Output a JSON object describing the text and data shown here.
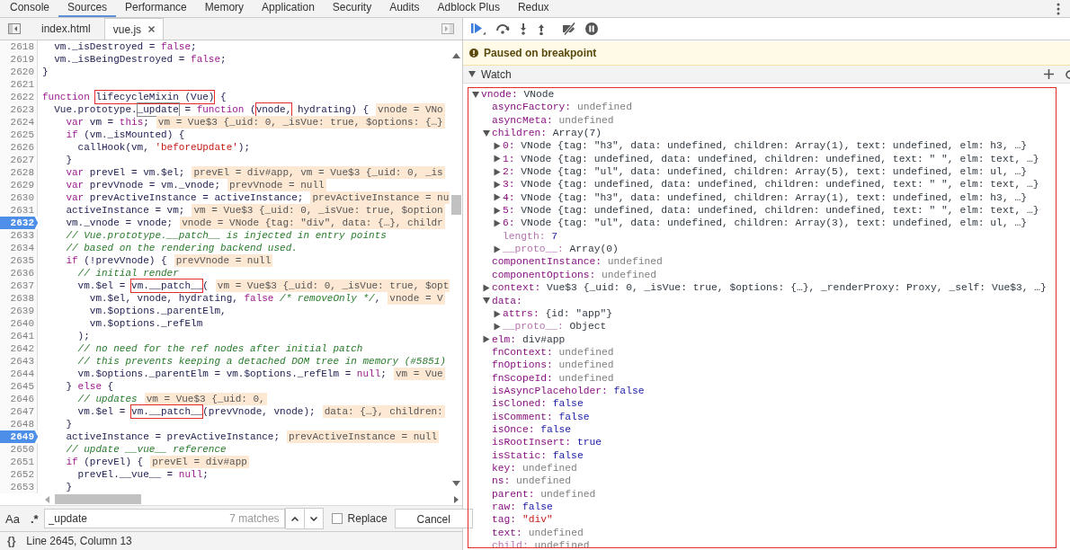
{
  "tabs": [
    {
      "label": "Console",
      "selected": false
    },
    {
      "label": "Sources",
      "selected": true
    },
    {
      "label": "Performance",
      "selected": false
    },
    {
      "label": "Memory",
      "selected": false
    },
    {
      "label": "Application",
      "selected": false
    },
    {
      "label": "Security",
      "selected": false
    },
    {
      "label": "Audits",
      "selected": false
    },
    {
      "label": "Adblock Plus",
      "selected": false
    },
    {
      "label": "Redux",
      "selected": false
    }
  ],
  "editor": {
    "files": [
      {
        "label": "index.html",
        "selected": false,
        "closable": false
      },
      {
        "label": "vue.js",
        "selected": true,
        "closable": true
      }
    ],
    "lines": [
      {
        "number": "2618",
        "breakpoint": false,
        "segments": [
          {
            "kind": "plain",
            "text": "  vm._isDestroyed = "
          },
          {
            "kind": "kw",
            "text": "false"
          },
          {
            "kind": "plain",
            "text": ";"
          }
        ]
      },
      {
        "number": "2619",
        "breakpoint": false,
        "segments": [
          {
            "kind": "plain",
            "text": "  vm._isBeingDestroyed = "
          },
          {
            "kind": "kw",
            "text": "false"
          },
          {
            "kind": "plain",
            "text": ";"
          }
        ]
      },
      {
        "number": "2620",
        "breakpoint": false,
        "segments": [
          {
            "kind": "plain",
            "text": "}"
          }
        ]
      },
      {
        "number": "2621",
        "breakpoint": false
      },
      {
        "number": "2622",
        "breakpoint": false,
        "segments": [
          {
            "kind": "kw",
            "text": "function "
          },
          {
            "kind": "plain",
            "text": "lifecycleMixin (Vue)",
            "annotated": true
          },
          {
            "kind": "plain",
            "text": " {"
          }
        ]
      },
      {
        "number": "2623",
        "breakpoint": false,
        "segments": [
          {
            "kind": "plain",
            "text": "  Vue.prototype."
          },
          {
            "kind": "plain",
            "text": "_update",
            "search_match": true
          },
          {
            "kind": "plain",
            "text": " = "
          },
          {
            "kind": "kw",
            "text": "function"
          },
          {
            "kind": "plain",
            "text": " ("
          },
          {
            "kind": "plain",
            "text": "vnode,",
            "annotated": true
          },
          {
            "kind": "plain",
            "text": " hydrating) {"
          }
        ],
        "hint": "vnode = VNo"
      },
      {
        "number": "2624",
        "breakpoint": false,
        "segments": [
          {
            "kind": "kw",
            "text": "    var"
          },
          {
            "kind": "plain",
            "text": " vm = "
          },
          {
            "kind": "kw",
            "text": "this"
          },
          {
            "kind": "plain",
            "text": ";"
          }
        ],
        "hint": "vm = Vue$3 {_uid: 0, _isVue: true, $options: {…}"
      },
      {
        "number": "2625",
        "breakpoint": false,
        "segments": [
          {
            "kind": "kw",
            "text": "    if"
          },
          {
            "kind": "plain",
            "text": " (vm._isMounted) {"
          }
        ]
      },
      {
        "number": "2626",
        "breakpoint": false,
        "segments": [
          {
            "kind": "plain",
            "text": "      callHook(vm, "
          },
          {
            "kind": "str",
            "text": "'beforeUpdate'"
          },
          {
            "kind": "plain",
            "text": ");"
          }
        ]
      },
      {
        "number": "2627",
        "breakpoint": false,
        "segments": [
          {
            "kind": "plain",
            "text": "    }"
          }
        ]
      },
      {
        "number": "2628",
        "breakpoint": false,
        "segments": [
          {
            "kind": "kw",
            "text": "    var"
          },
          {
            "kind": "plain",
            "text": " prevEl = vm.$el;"
          }
        ],
        "hint": "prevEl = div#app, vm = Vue$3 {_uid: 0, _is"
      },
      {
        "number": "2629",
        "breakpoint": false,
        "segments": [
          {
            "kind": "kw",
            "text": "    var"
          },
          {
            "kind": "plain",
            "text": " prevVnode = vm._vnode;"
          }
        ],
        "hint": "prevVnode = null"
      },
      {
        "number": "2630",
        "breakpoint": false,
        "segments": [
          {
            "kind": "kw",
            "text": "    var"
          },
          {
            "kind": "plain",
            "text": " prevActiveInstance = activeInstance;"
          }
        ],
        "hint": "prevActiveInstance = nu"
      },
      {
        "number": "2631",
        "breakpoint": false,
        "segments": [
          {
            "kind": "plain",
            "text": "    activeInstance = vm;"
          }
        ],
        "hint": "vm = Vue$3 {_uid: 0, _isVue: true, $option"
      },
      {
        "number": "2632",
        "breakpoint": true,
        "segments": [
          {
            "kind": "plain",
            "text": "    vm._vnode = vnode;"
          }
        ],
        "hint": "vnode = VNode {tag: \"div\", data: {…}, childr"
      },
      {
        "number": "2633",
        "breakpoint": false,
        "segments": [
          {
            "kind": "cm",
            "text": "    // Vue.prototype.__patch__ is injected in entry points"
          }
        ]
      },
      {
        "number": "2634",
        "breakpoint": false,
        "segments": [
          {
            "kind": "cm",
            "text": "    // based on the rendering backend used."
          }
        ]
      },
      {
        "number": "2635",
        "breakpoint": false,
        "segments": [
          {
            "kind": "kw",
            "text": "    if"
          },
          {
            "kind": "plain",
            "text": " (!prevVnode) {"
          }
        ],
        "hint": "prevVnode = null"
      },
      {
        "number": "2636",
        "breakpoint": false,
        "segments": [
          {
            "kind": "cm",
            "text": "      // initial render"
          }
        ]
      },
      {
        "number": "2637",
        "breakpoint": false,
        "segments": [
          {
            "kind": "plain",
            "text": "      vm.$el = "
          },
          {
            "kind": "plain",
            "text": "vm.__patch__",
            "annotated": true
          },
          {
            "kind": "plain",
            "text": "("
          }
        ],
        "hint": "vm = Vue$3 {_uid: 0, _isVue: true, $opt"
      },
      {
        "number": "2638",
        "breakpoint": false,
        "segments": [
          {
            "kind": "plain",
            "text": "        vm.$el, vnode, hydrating, "
          },
          {
            "kind": "kw",
            "text": "false "
          },
          {
            "kind": "cm",
            "text": "/* removeOnly */"
          },
          {
            "kind": "plain",
            "text": ","
          }
        ],
        "hint": "vnode = V"
      },
      {
        "number": "2639",
        "breakpoint": false,
        "segments": [
          {
            "kind": "plain",
            "text": "        vm.$options._parentElm,"
          }
        ]
      },
      {
        "number": "2640",
        "breakpoint": false,
        "segments": [
          {
            "kind": "plain",
            "text": "        vm.$options._refElm"
          }
        ]
      },
      {
        "number": "2641",
        "breakpoint": false,
        "segments": [
          {
            "kind": "plain",
            "text": "      );"
          }
        ]
      },
      {
        "number": "2642",
        "breakpoint": false,
        "segments": [
          {
            "kind": "cm",
            "text": "      // no need for the ref nodes after initial patch"
          }
        ]
      },
      {
        "number": "2643",
        "breakpoint": false,
        "segments": [
          {
            "kind": "cm",
            "text": "      // this prevents keeping a detached DOM tree in memory (#5851)"
          }
        ]
      },
      {
        "number": "2644",
        "breakpoint": false,
        "segments": [
          {
            "kind": "plain",
            "text": "      vm.$options._parentElm = vm.$options._refElm = "
          },
          {
            "kind": "kw",
            "text": "null"
          },
          {
            "kind": "plain",
            "text": ";"
          }
        ],
        "hint": "vm = Vue"
      },
      {
        "number": "2645",
        "breakpoint": false,
        "segments": [
          {
            "kind": "plain",
            "text": "    } "
          },
          {
            "kind": "kw",
            "text": "else"
          },
          {
            "kind": "plain",
            "text": " {"
          }
        ]
      },
      {
        "number": "2646",
        "breakpoint": false,
        "segments": [
          {
            "kind": "cm",
            "text": "      // updates"
          }
        ],
        "hint": "vm = Vue$3 {_uid: 0,"
      },
      {
        "number": "2647",
        "breakpoint": false,
        "segments": [
          {
            "kind": "plain",
            "text": "      vm.$el = "
          },
          {
            "kind": "plain",
            "text": "vm.__patch__",
            "annotated": true
          },
          {
            "kind": "plain",
            "text": "(prevVnode, vnode);"
          }
        ],
        "hint": "data: {…}, children:"
      },
      {
        "number": "2648",
        "breakpoint": false,
        "segments": [
          {
            "kind": "plain",
            "text": "    }"
          }
        ]
      },
      {
        "number": "2649",
        "breakpoint": true,
        "segments": [
          {
            "kind": "plain",
            "text": "    activeInstance = prevActiveInstance;"
          }
        ],
        "hint": "prevActiveInstance = null"
      },
      {
        "number": "2650",
        "breakpoint": false,
        "segments": [
          {
            "kind": "cm",
            "text": "    // update __vue__ reference"
          }
        ]
      },
      {
        "number": "2651",
        "breakpoint": false,
        "segments": [
          {
            "kind": "kw",
            "text": "    if"
          },
          {
            "kind": "plain",
            "text": " (prevEl) {"
          }
        ],
        "hint": "prevEl = div#app"
      },
      {
        "number": "2652",
        "breakpoint": false,
        "segments": [
          {
            "kind": "plain",
            "text": "      prevEl.__vue__ = "
          },
          {
            "kind": "kw",
            "text": "null"
          },
          {
            "kind": "plain",
            "text": ";"
          }
        ]
      },
      {
        "number": "2653",
        "breakpoint": false,
        "segments": [
          {
            "kind": "plain",
            "text": "    }"
          }
        ]
      }
    ]
  },
  "search": {
    "case_label": "Aa",
    "regex_label": ".*",
    "value": "_update",
    "matches": "7 matches",
    "replace": {
      "label": "Replace",
      "checked": false
    },
    "cancel": "Cancel"
  },
  "status_bar": {
    "format_label": "{}",
    "position": "Line 2645, Column 13"
  },
  "debugger": {
    "banner": "Paused on breakpoint"
  },
  "watch": {
    "title": "Watch",
    "expanded": true,
    "annotated": true,
    "items": [
      {
        "key": "vnode:",
        "value": "VNode",
        "kind": "obj",
        "expanded": true,
        "children": [
          {
            "key": "asyncFactory:",
            "value": "undefined",
            "kind": "undef"
          },
          {
            "key": "asyncMeta:",
            "value": "undefined",
            "kind": "undef"
          },
          {
            "key": "children:",
            "value": "Array(7)",
            "kind": "obj",
            "expanded": true,
            "children": [
              {
                "key": "0:",
                "value": "VNode {tag: \"h3\", data: undefined, children: Array(1), text: undefined, elm: h3, …}",
                "kind": "obj",
                "expanded": false
              },
              {
                "key": "1:",
                "value": "VNode {tag: undefined, data: undefined, children: undefined, text: \" \", elm: text, …}",
                "kind": "obj",
                "expanded": false
              },
              {
                "key": "2:",
                "value": "VNode {tag: \"ul\", data: undefined, children: Array(5), text: undefined, elm: ul, …}",
                "kind": "obj",
                "expanded": false
              },
              {
                "key": "3:",
                "value": "VNode {tag: undefined, data: undefined, children: undefined, text: \" \", elm: text, …}",
                "kind": "obj",
                "expanded": false
              },
              {
                "key": "4:",
                "value": "VNode {tag: \"h3\", data: undefined, children: Array(1), text: undefined, elm: h3, …}",
                "kind": "obj",
                "expanded": false
              },
              {
                "key": "5:",
                "value": "VNode {tag: undefined, data: undefined, children: undefined, text: \" \", elm: text, …}",
                "kind": "obj",
                "expanded": false
              },
              {
                "key": "6:",
                "value": "VNode {tag: \"ul\", data: undefined, children: Array(3), text: undefined, elm: ul, …}",
                "kind": "obj",
                "expanded": false
              },
              {
                "key": "length:",
                "value": "7",
                "kind": "num",
                "dim": true
              },
              {
                "key": "__proto__:",
                "value": "Array(0)",
                "kind": "obj",
                "dim": true,
                "expanded": false
              }
            ]
          },
          {
            "key": "componentInstance:",
            "value": "undefined",
            "kind": "undef"
          },
          {
            "key": "componentOptions:",
            "value": "undefined",
            "kind": "undef"
          },
          {
            "key": "context:",
            "value": "Vue$3 {_uid: 0, _isVue: true, $options: {…}, _renderProxy: Proxy, _self: Vue$3, …}",
            "kind": "obj",
            "expanded": false
          },
          {
            "key": "data:",
            "expanded": true,
            "children": [
              {
                "key": "attrs:",
                "value": "{id: \"app\"}",
                "kind": "obj",
                "expanded": false
              },
              {
                "key": "__proto__:",
                "value": "Object",
                "kind": "obj",
                "dim": true,
                "expanded": false
              }
            ]
          },
          {
            "key": "elm:",
            "value": "div#app",
            "kind": "obj",
            "expanded": false
          },
          {
            "key": "fnContext:",
            "value": "undefined",
            "kind": "undef"
          },
          {
            "key": "fnOptions:",
            "value": "undefined",
            "kind": "undef"
          },
          {
            "key": "fnScopeId:",
            "value": "undefined",
            "kind": "undef"
          },
          {
            "key": "isAsyncPlaceholder:",
            "value": "false",
            "kind": "bool"
          },
          {
            "key": "isCloned:",
            "value": "false",
            "kind": "bool"
          },
          {
            "key": "isComment:",
            "value": "false",
            "kind": "bool"
          },
          {
            "key": "isOnce:",
            "value": "false",
            "kind": "bool"
          },
          {
            "key": "isRootInsert:",
            "value": "true",
            "kind": "bool"
          },
          {
            "key": "isStatic:",
            "value": "false",
            "kind": "bool"
          },
          {
            "key": "key:",
            "value": "undefined",
            "kind": "undef"
          },
          {
            "key": "ns:",
            "value": "undefined",
            "kind": "undef"
          },
          {
            "key": "parent:",
            "value": "undefined",
            "kind": "undef"
          },
          {
            "key": "raw:",
            "value": "false",
            "kind": "bool"
          },
          {
            "key": "tag:",
            "value": "\"div\"",
            "kind": "str"
          },
          {
            "key": "text:",
            "value": "undefined",
            "kind": "undef"
          },
          {
            "key": "child:",
            "value": "undefined",
            "kind": "undef",
            "dim": true
          }
        ]
      }
    ]
  }
}
